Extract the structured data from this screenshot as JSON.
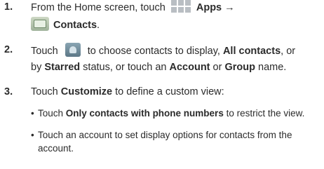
{
  "steps": [
    {
      "num": "1.",
      "text_a": "From the Home screen, touch",
      "apps_label": "Apps",
      "arrow": "→",
      "contacts_label": "Contacts",
      "period": "."
    },
    {
      "num": "2.",
      "line1_a": "Touch",
      "line1_b": "to choose contacts to display,",
      "all_contacts": "All contacts",
      "line1_c": ", or",
      "line2_a": "by",
      "starred": "Starred",
      "line2_b": "status, or touch an",
      "account": "Account",
      "line2_c": "or",
      "group": "Group",
      "line2_d": "name."
    },
    {
      "num": "3.",
      "text_a": "Touch",
      "customize": "Customize",
      "text_b": "to define a custom view:"
    }
  ],
  "bullets": [
    {
      "a": "Touch",
      "b": "Only contacts with phone numbers",
      "c": "to restrict the view."
    },
    {
      "a": "Touch an account to set display options for contacts from the",
      "a2": "account."
    }
  ],
  "icons": {
    "apps": "apps-grid-icon",
    "contacts": "contacts-folder-icon",
    "display": "display-options-icon"
  }
}
